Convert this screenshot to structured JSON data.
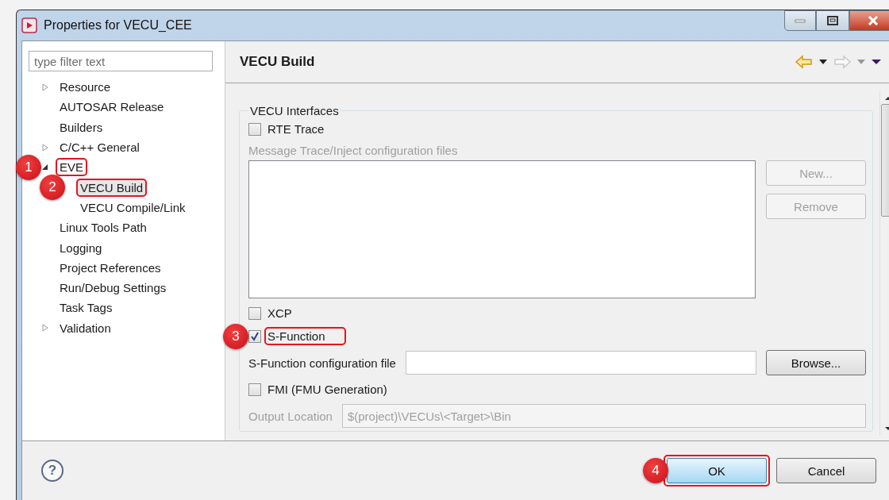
{
  "window": {
    "title": "Properties for VECU_CEE"
  },
  "filter": {
    "placeholder": "type filter text"
  },
  "tree": [
    {
      "label": "Resource",
      "expandable": true,
      "expanded": false,
      "selected": false
    },
    {
      "label": "AUTOSAR Release",
      "expandable": false,
      "selected": false
    },
    {
      "label": "Builders",
      "expandable": false,
      "selected": false
    },
    {
      "label": "C/C++ General",
      "expandable": true,
      "expanded": false,
      "selected": false
    },
    {
      "label": "EVE",
      "expandable": true,
      "expanded": true,
      "selected": false,
      "callout": "1",
      "children": [
        {
          "label": "VECU Build",
          "selected": true,
          "callout": "2"
        },
        {
          "label": "VECU Compile/Link",
          "selected": false
        }
      ]
    },
    {
      "label": "Linux Tools Path",
      "expandable": false,
      "selected": false
    },
    {
      "label": "Logging",
      "expandable": false,
      "selected": false
    },
    {
      "label": "Project References",
      "expandable": false,
      "selected": false
    },
    {
      "label": "Run/Debug Settings",
      "expandable": false,
      "selected": false
    },
    {
      "label": "Task Tags",
      "expandable": false,
      "selected": false
    },
    {
      "label": "Validation",
      "expandable": true,
      "expanded": false,
      "selected": false
    }
  ],
  "page": {
    "title": "VECU Build"
  },
  "group": {
    "title": "VECU Interfaces",
    "rows": [
      {
        "kind": "checkbox",
        "label": "RTE Trace",
        "checked": false
      },
      {
        "kind": "caption",
        "label": "Message Trace/Inject configuration files",
        "disabled": true
      },
      {
        "kind": "list",
        "buttons": [
          {
            "label": "New...",
            "disabled": true
          },
          {
            "label": "Remove",
            "disabled": true
          }
        ]
      },
      {
        "kind": "checkbox",
        "label": "XCP",
        "checked": false
      },
      {
        "kind": "checkbox",
        "label": "S-Function",
        "checked": true,
        "callout": "3"
      },
      {
        "kind": "field",
        "label": "S-Function configuration file",
        "disabled": false,
        "button": {
          "label": "Browse...",
          "disabled": false
        }
      },
      {
        "kind": "checkbox",
        "label": "FMI (FMU Generation)",
        "checked": false
      },
      {
        "kind": "field",
        "label": "Output Location",
        "value": "$(project)\\VECUs\\<Target>\\Bin",
        "disabled": true
      }
    ]
  },
  "help": "?",
  "buttons": [
    {
      "label": "OK",
      "default": true,
      "callout": "4"
    },
    {
      "label": "Cancel",
      "default": false
    }
  ]
}
